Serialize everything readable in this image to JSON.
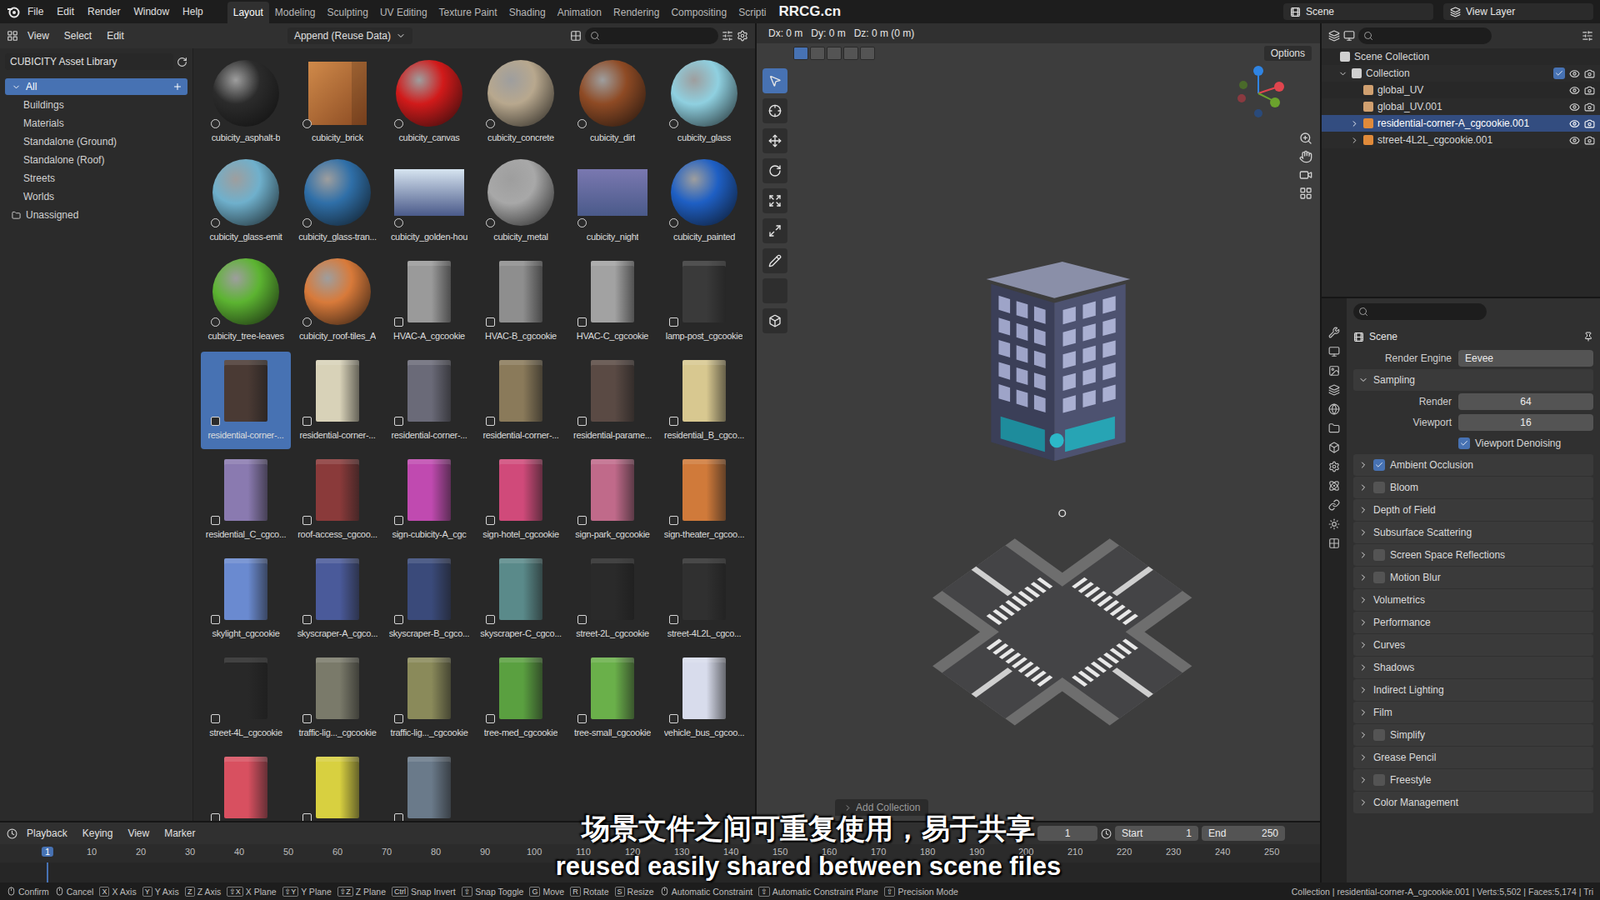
{
  "menu": [
    "File",
    "Edit",
    "Render",
    "Window",
    "Help"
  ],
  "workspaces": [
    {
      "label": "Layout",
      "selected": true
    },
    {
      "label": "Modeling",
      "selected": false
    },
    {
      "label": "Sculpting",
      "selected": false
    },
    {
      "label": "UV Editing",
      "selected": false
    },
    {
      "label": "Texture Paint",
      "selected": false
    },
    {
      "label": "Shading",
      "selected": false
    },
    {
      "label": "Animation",
      "selected": false
    },
    {
      "label": "Rendering",
      "selected": false
    },
    {
      "label": "Compositing",
      "selected": false
    },
    {
      "label": "Scripti",
      "selected": false
    }
  ],
  "watermark": "RRCG.cn",
  "scene": "Scene",
  "view_layer": "View Layer",
  "asset_browser": {
    "menu": [
      "View",
      "Select",
      "Edit"
    ],
    "import_mode": "Append (Reuse Data)",
    "library": "CUBICITY Asset Library",
    "catalogs": [
      {
        "label": "All",
        "level": 0,
        "selected": true
      },
      {
        "label": "Buildings",
        "level": 1,
        "selected": false
      },
      {
        "label": "Materials",
        "level": 1,
        "selected": false
      },
      {
        "label": "Standalone (Ground)",
        "level": 1,
        "selected": false
      },
      {
        "label": "Standalone (Roof)",
        "level": 1,
        "selected": false
      },
      {
        "label": "Streets",
        "level": 1,
        "selected": false
      },
      {
        "label": "Worlds",
        "level": 1,
        "selected": false
      },
      {
        "label": "Unassigned",
        "level": 0,
        "selected": false
      }
    ],
    "assets": [
      {
        "name": "cubicity_asphalt-b",
        "kind": "material",
        "color": "#2b2b2b",
        "selected": false
      },
      {
        "name": "cubicity_brick",
        "kind": "material-box",
        "color": "#d08a4a",
        "selected": false
      },
      {
        "name": "cubicity_canvas",
        "kind": "material",
        "color": "#d11a1a",
        "selected": false
      },
      {
        "name": "cubicity_concrete",
        "kind": "material",
        "color": "#b8a88e",
        "selected": false
      },
      {
        "name": "cubicity_dirt",
        "kind": "material",
        "color": "#8e4a24",
        "selected": false
      },
      {
        "name": "cubicity_glass",
        "kind": "material",
        "color": "#8fd0e0",
        "selected": false
      },
      {
        "name": "cubicity_glass-emit",
        "kind": "material",
        "color": "#6fb0cc",
        "selected": false
      },
      {
        "name": "cubicity_glass-tran...",
        "kind": "material",
        "color": "#2f6fa8",
        "selected": false
      },
      {
        "name": "cubicity_golden-hou",
        "kind": "world",
        "color": "#d6e4f0",
        "selected": false
      },
      {
        "name": "cubicity_metal",
        "kind": "material",
        "color": "#a8a8a8",
        "selected": false
      },
      {
        "name": "cubicity_night",
        "kind": "world",
        "color": "#7a78b0",
        "selected": false
      },
      {
        "name": "cubicity_painted",
        "kind": "material",
        "color": "#1e5fc4",
        "selected": false
      },
      {
        "name": "cubicity_tree-leaves",
        "kind": "material",
        "color": "#5cb431",
        "selected": false
      },
      {
        "name": "cubicity_roof-tiles_A",
        "kind": "material",
        "color": "#d87a3a",
        "selected": false
      },
      {
        "name": "HVAC-A_cgcookie",
        "kind": "object",
        "color": "#9a9a9a",
        "selected": false
      },
      {
        "name": "HVAC-B_cgcookie",
        "kind": "object",
        "color": "#8e8e8e",
        "selected": false
      },
      {
        "name": "HVAC-C_cgcookie",
        "kind": "object",
        "color": "#a2a2a2",
        "selected": false
      },
      {
        "name": "lamp-post_cgcookie",
        "kind": "object",
        "color": "#3a3a3a",
        "selected": false
      },
      {
        "name": "residential-corner-...",
        "kind": "object",
        "color": "#4a3a34",
        "selected": true
      },
      {
        "name": "residential-corner-...",
        "kind": "object",
        "color": "#d8d2b8",
        "selected": false
      },
      {
        "name": "residential-corner-...",
        "kind": "object",
        "color": "#6a6a78",
        "selected": false
      },
      {
        "name": "residential-corner-...",
        "kind": "object",
        "color": "#8a7a5a",
        "selected": false
      },
      {
        "name": "residential-parame...",
        "kind": "object",
        "color": "#5a4a44",
        "selected": false
      },
      {
        "name": "residential_B_cgco...",
        "kind": "object",
        "color": "#d8c890",
        "selected": false
      },
      {
        "name": "residential_C_cgco...",
        "kind": "object",
        "color": "#8a7ab0",
        "selected": false
      },
      {
        "name": "roof-access_cgcoo...",
        "kind": "object",
        "color": "#8a3a3a",
        "selected": false
      },
      {
        "name": "sign-cubicity-A_cgc",
        "kind": "object",
        "color": "#c04ab0",
        "selected": false
      },
      {
        "name": "sign-hotel_cgcookie",
        "kind": "object",
        "color": "#d04a7a",
        "selected": false
      },
      {
        "name": "sign-park_cgcookie",
        "kind": "object",
        "color": "#c06a8a",
        "selected": false
      },
      {
        "name": "sign-theater_cgcoo...",
        "kind": "object",
        "color": "#d07a3a",
        "selected": false
      },
      {
        "name": "skylight_cgcookie",
        "kind": "object",
        "color": "#6a8ad0",
        "selected": false
      },
      {
        "name": "skyscraper-A_cgco...",
        "kind": "object",
        "color": "#4a5a9a",
        "selected": false
      },
      {
        "name": "skyscraper-B_cgco...",
        "kind": "object",
        "color": "#3a4a7a",
        "selected": false
      },
      {
        "name": "skyscraper-C_cgco...",
        "kind": "object",
        "color": "#5a8a8a",
        "selected": false
      },
      {
        "name": "street-2L_cgcookie",
        "kind": "object",
        "color": "#2a2a2a",
        "selected": false
      },
      {
        "name": "street-4L2L_cgco...",
        "kind": "object",
        "color": "#303030",
        "selected": false
      },
      {
        "name": "street-4L_cgcookie",
        "kind": "object",
        "color": "#282828",
        "selected": false
      },
      {
        "name": "traffic-lig..._cgcookie",
        "kind": "object",
        "color": "#7a7a6a",
        "selected": false
      },
      {
        "name": "traffic-lig..._cgcookie",
        "kind": "object",
        "color": "#8a8a5a",
        "selected": false
      },
      {
        "name": "tree-med_cgcookie",
        "kind": "object",
        "color": "#5aa040",
        "selected": false
      },
      {
        "name": "tree-small_cgcookie",
        "kind": "object",
        "color": "#6ab04a",
        "selected": false
      },
      {
        "name": "vehicle_bus_cgcoo...",
        "kind": "object",
        "color": "#d8dcec",
        "selected": false
      },
      {
        "name": "",
        "kind": "object",
        "color": "#d85060",
        "selected": false
      },
      {
        "name": "",
        "kind": "object",
        "color": "#d8d040",
        "selected": false
      },
      {
        "name": "",
        "kind": "object",
        "color": "#6a7a8a",
        "selected": false
      }
    ]
  },
  "viewport": {
    "deltas": [
      "Dx: 0 m",
      "Dy: 0 m",
      "Dz: 0 m (0 m)"
    ],
    "options": "Options",
    "last_operation": "Add Collection"
  },
  "outliner": {
    "items": [
      {
        "label": "Scene Collection",
        "depth": 0,
        "kind": "scene",
        "expandable": false,
        "expanded": false,
        "selected": false,
        "checkbox": false
      },
      {
        "label": "Collection",
        "depth": 1,
        "kind": "collection",
        "expandable": true,
        "expanded": true,
        "selected": false,
        "checkbox": true
      },
      {
        "label": "global_UV",
        "depth": 2,
        "kind": "armature",
        "expandable": false,
        "expanded": false,
        "selected": false,
        "checkbox": false
      },
      {
        "label": "global_UV.001",
        "depth": 2,
        "kind": "armature",
        "expandable": false,
        "expanded": false,
        "selected": false,
        "checkbox": false
      },
      {
        "label": "residential-corner-A_cgcookie.001",
        "depth": 2,
        "kind": "object",
        "expandable": true,
        "expanded": false,
        "selected": true,
        "checkbox": false
      },
      {
        "label": "street-4L2L_cgcookie.001",
        "depth": 2,
        "kind": "object",
        "expandable": true,
        "expanded": false,
        "selected": false,
        "checkbox": false
      }
    ]
  },
  "properties": {
    "context": "Scene",
    "render_engine": {
      "label": "Render Engine",
      "value": "Eevee"
    },
    "sampling": {
      "label": "Sampling",
      "expanded": true,
      "fields": [
        {
          "label": "Render",
          "value": "64"
        },
        {
          "label": "Viewport",
          "value": "16"
        }
      ],
      "denoising": {
        "label": "Viewport Denoising",
        "checked": true
      }
    },
    "panels": [
      {
        "label": "Ambient Occlusion",
        "kind": "toggle",
        "checked": true,
        "expanded": false
      },
      {
        "label": "Bloom",
        "kind": "toggle",
        "checked": false,
        "expanded": false
      },
      {
        "label": "Depth of Field",
        "kind": "plain",
        "checked": false,
        "expanded": false
      },
      {
        "label": "Subsurface Scattering",
        "kind": "plain",
        "checked": false,
        "expanded": false
      },
      {
        "label": "Screen Space Reflections",
        "kind": "toggle",
        "checked": false,
        "expanded": false
      },
      {
        "label": "Motion Blur",
        "kind": "toggle",
        "checked": false,
        "expanded": false
      },
      {
        "label": "Volumetrics",
        "kind": "plain",
        "checked": false,
        "expanded": false
      },
      {
        "label": "Performance",
        "kind": "plain",
        "checked": false,
        "expanded": false
      },
      {
        "label": "Curves",
        "kind": "plain",
        "checked": false,
        "expanded": false
      },
      {
        "label": "Shadows",
        "kind": "plain",
        "checked": false,
        "expanded": false
      },
      {
        "label": "Indirect Lighting",
        "kind": "plain",
        "checked": false,
        "expanded": false
      },
      {
        "label": "Film",
        "kind": "plain",
        "checked": false,
        "expanded": false
      },
      {
        "label": "Simplify",
        "kind": "toggle",
        "checked": false,
        "expanded": false
      },
      {
        "label": "Grease Pencil",
        "kind": "plain",
        "checked": false,
        "expanded": false
      },
      {
        "label": "Freestyle",
        "kind": "toggle",
        "checked": false,
        "expanded": false
      },
      {
        "label": "Color Management",
        "kind": "plain",
        "checked": false,
        "expanded": false
      }
    ]
  },
  "timeline": {
    "menu": [
      "Playback",
      "Keying",
      "View",
      "Marker"
    ],
    "current_frame": "1",
    "start": {
      "label": "Start",
      "value": "1"
    },
    "end": {
      "label": "End",
      "value": "250"
    },
    "ticks": [
      "1",
      "10",
      "20",
      "30",
      "40",
      "50",
      "60",
      "70",
      "80",
      "90",
      "100",
      "110",
      "120",
      "130",
      "140",
      "150",
      "160",
      "170",
      "180",
      "190",
      "200",
      "210",
      "220",
      "230",
      "240",
      "250"
    ]
  },
  "status": {
    "items": [
      {
        "key": "",
        "label": "Confirm"
      },
      {
        "key": "",
        "label": "Cancel"
      },
      {
        "key": "X",
        "label": "X Axis"
      },
      {
        "key": "Y",
        "label": "Y Axis"
      },
      {
        "key": "Z",
        "label": "Z Axis"
      },
      {
        "key": "⇧X",
        "label": "X Plane"
      },
      {
        "key": "⇧Y",
        "label": "Y Plane"
      },
      {
        "key": "⇧Z",
        "label": "Z Plane"
      },
      {
        "key": "Ctrl",
        "label": "Snap Invert"
      },
      {
        "key": "⇧",
        "label": "Snap Toggle"
      },
      {
        "key": "G",
        "label": "Move"
      },
      {
        "key": "R",
        "label": "Rotate"
      },
      {
        "key": "S",
        "label": "Resize"
      },
      {
        "key": "",
        "label": "Automatic Constraint"
      },
      {
        "key": "⇧",
        "label": "Automatic Constraint Plane"
      },
      {
        "key": "⇧",
        "label": "Precision Mode"
      }
    ],
    "info": "Collection | residential-corner-A_cgcookie.001 | Verts:5,502 | Faces:5,174 | Tri"
  },
  "subtitles": {
    "zh": "场景文件之间可重复使用，易于共享",
    "en": "reused easily shared between scene files"
  }
}
